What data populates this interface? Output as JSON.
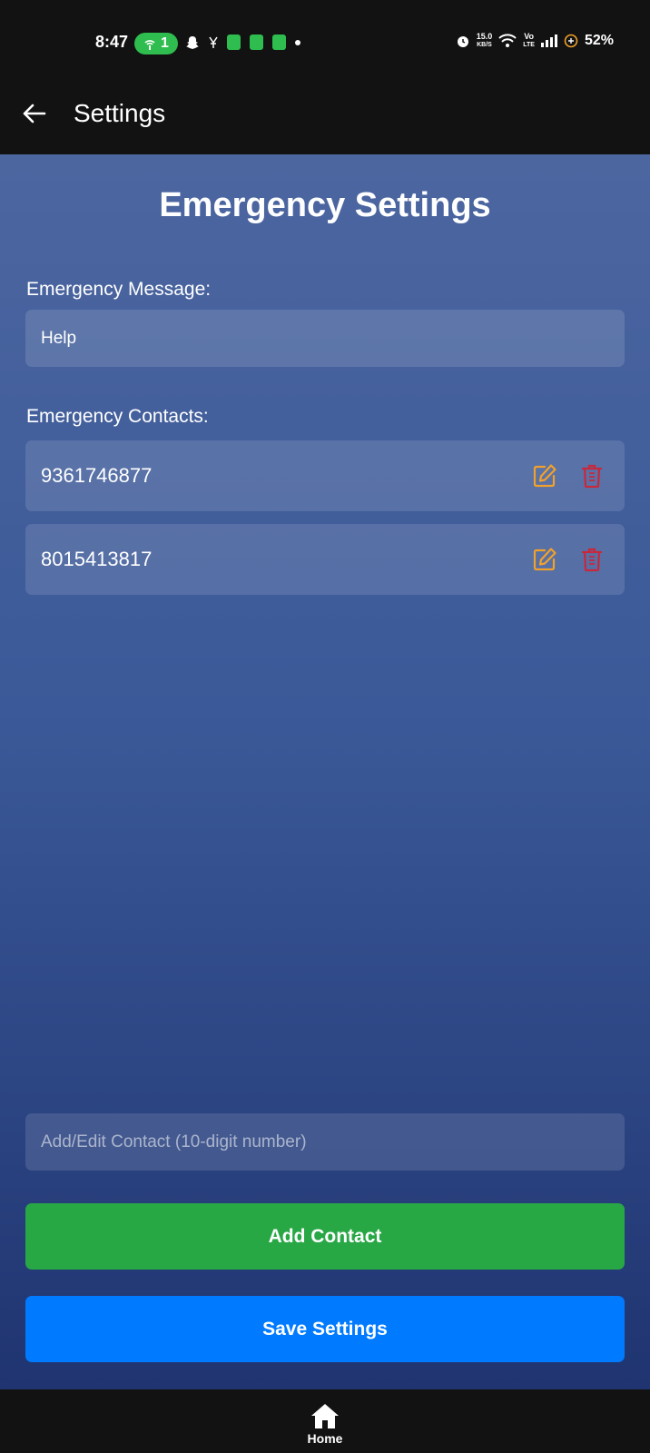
{
  "status_bar": {
    "time": "8:47",
    "hotspot_count": "1",
    "speed_value": "15.0",
    "speed_unit": "KB/S",
    "volte_top": "Vo",
    "volte_bottom": "LTE",
    "battery": "52%"
  },
  "app_bar": {
    "title": "Settings",
    "back_icon": "arrow-left-icon"
  },
  "main": {
    "heading": "Emergency Settings",
    "message_label": "Emergency Message:",
    "message_value": "Help",
    "contacts_label": "Emergency Contacts:",
    "contacts": [
      {
        "number": "9361746877"
      },
      {
        "number": "8015413817"
      }
    ],
    "contact_input_placeholder": "Add/Edit Contact (10-digit number)",
    "add_button": "Add Contact",
    "save_button": "Save Settings"
  },
  "tab_bar": {
    "home_label": "Home",
    "home_icon": "home-icon"
  },
  "colors": {
    "edit_icon": "#f0a12b",
    "delete_icon": "#c8283c",
    "add_button": "#28a745",
    "save_button": "#007bff",
    "hotspot_pill": "#2ebd4e"
  }
}
